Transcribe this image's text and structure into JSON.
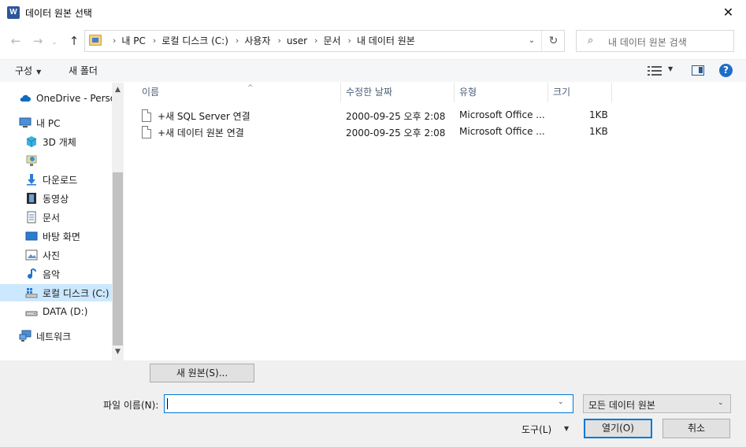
{
  "window": {
    "title": "데이터 원본 선택",
    "app_icon": "W",
    "close_glyph": "✕"
  },
  "nav": {
    "back": "←",
    "forward": "→",
    "recent": "⌄",
    "up": "↑",
    "breadcrumbs": [
      "내 PC",
      "로컬 디스크 (C:)",
      "사용자",
      "user",
      "문서",
      "내 데이터 원본"
    ],
    "crumb_separator": "›",
    "dropdown_glyph": "⌄",
    "refresh_glyph": "↻",
    "search_placeholder": "내 데이터 원본 검색",
    "search_glyph": "⌕"
  },
  "toolbar": {
    "organize_label": "구성",
    "organize_caret": "▼",
    "new_folder_label": "새 폴더",
    "view_caret": "▼",
    "help_glyph": "?"
  },
  "sidebar": {
    "items": [
      {
        "label": "OneDrive - Personal",
        "icon": "cloud-icon"
      },
      {
        "label": "내 PC",
        "icon": "computer-icon"
      },
      {
        "label": "3D 개체",
        "icon": "cube-icon"
      },
      {
        "label": "",
        "icon": "network-drive-icon"
      },
      {
        "label": "다운로드",
        "icon": "download-arrow-icon"
      },
      {
        "label": "동영상",
        "icon": "film-icon"
      },
      {
        "label": "문서",
        "icon": "document-icon"
      },
      {
        "label": "바탕 화면",
        "icon": "desktop-icon"
      },
      {
        "label": "사진",
        "icon": "picture-icon"
      },
      {
        "label": "음악",
        "icon": "music-note-icon"
      },
      {
        "label": "로컬 디스크 (C:)",
        "icon": "windows-drive-icon"
      },
      {
        "label": "DATA (D:)",
        "icon": "drive-icon"
      },
      {
        "label": "네트워크",
        "icon": "network-icon"
      }
    ],
    "selected_index": 10,
    "scroll_up": "▲",
    "scroll_down": "▼"
  },
  "file_list": {
    "columns": [
      "이름",
      "수정한 날짜",
      "유형",
      "크기"
    ],
    "sort_glyph": "^",
    "rows": [
      {
        "name": "+새 SQL Server 연결",
        "modified": "2000-09-25 오후 2:08",
        "type": "Microsoft Office ...",
        "size": "1KB"
      },
      {
        "name": "+새 데이터 원본 연결",
        "modified": "2000-09-25 오후 2:08",
        "type": "Microsoft Office ...",
        "size": "1KB"
      }
    ]
  },
  "footer": {
    "new_source_label": "새 원본(S)...",
    "filename_label": "파일 이름(N):",
    "filename_value": "",
    "filename_dd": "⌄",
    "filetype_value": "모든 데이터 원본",
    "filetype_caret": "⌄",
    "tools_label": "도구(L)",
    "tools_caret": "▼",
    "open_label": "열기(O)",
    "cancel_label": "취소"
  },
  "colors": {
    "accent": "#0078d7",
    "selection": "#cce8ff",
    "help": "#1e6ec8",
    "word": "#2b579a"
  }
}
